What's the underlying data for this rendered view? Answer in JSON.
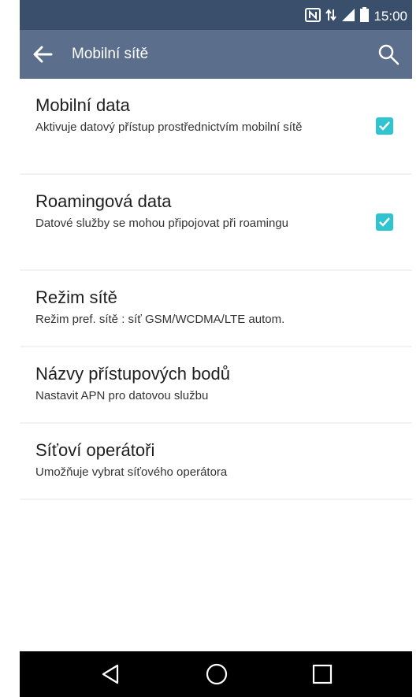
{
  "status_bar": {
    "time": "15:00",
    "icons": [
      "nfc-icon",
      "network-icon",
      "signal-icon",
      "battery-icon"
    ]
  },
  "app_bar": {
    "title": "Mobilní sítě",
    "back_icon": "arrow-left-icon",
    "search_icon": "search-icon",
    "background": "#5b6f8c"
  },
  "settings": [
    {
      "title": "Mobilní data",
      "subtitle": "Aktivuje datový přístup prostřednictvím mobilní sítě",
      "checked": true
    },
    {
      "title": "Roamingová data",
      "subtitle": "Datové služby se mohou připojovat při roamingu",
      "checked": true
    },
    {
      "title": "Režim sítě",
      "subtitle": "Režim pref. sítě : síť GSM/WCDMA/LTE autom."
    },
    {
      "title": "Názvy přístupových bodů",
      "subtitle": "Nastavit APN pro datovou službu"
    },
    {
      "title": "Síťoví operátoři",
      "subtitle": "Umožňuje vybrat síťového operátora"
    }
  ],
  "checkbox_color": "#2fc4cf",
  "nav_bar": {
    "buttons": [
      "back-triangle-icon",
      "home-circle-icon",
      "recents-square-icon"
    ]
  }
}
